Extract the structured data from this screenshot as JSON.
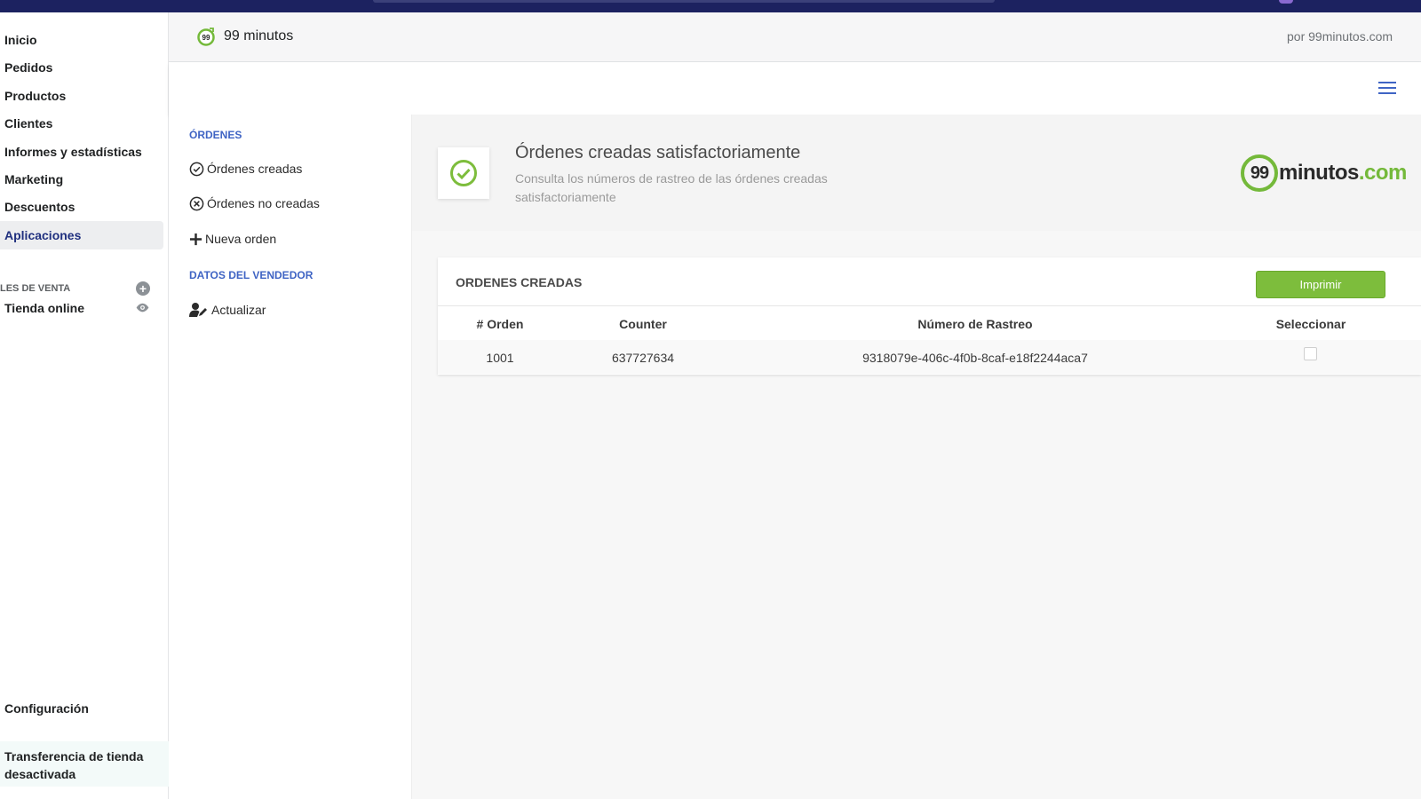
{
  "admin_nav": {
    "items": [
      {
        "label": "Inicio"
      },
      {
        "label": "Pedidos"
      },
      {
        "label": "Productos"
      },
      {
        "label": "Clientes"
      },
      {
        "label": "Informes y estadísticas"
      },
      {
        "label": "Marketing"
      },
      {
        "label": "Descuentos"
      },
      {
        "label": "Aplicaciones",
        "active": true
      }
    ],
    "channels_label": "LES DE VENTA",
    "channel_item": "Tienda online",
    "settings": "Configuración",
    "transfer": "Transferencia de tienda desactivada"
  },
  "app_header": {
    "title": "99 minutos",
    "by": "por 99minutos.com",
    "logo_badge": "99"
  },
  "side_nav": {
    "orders_heading": "ÓRDENES",
    "created": "Órdenes creadas",
    "not_created": "Órdenes no creadas",
    "new_order": "Nueva orden",
    "vendor_heading": "DATOS DEL VENDEDOR",
    "update": "Actualizar"
  },
  "banner": {
    "title": "Órdenes creadas satisfactoriamente",
    "description": "Consulta los números de rastreo de las órdenes creadas satisfactoriamente",
    "brand_number": "99",
    "brand_name": "minutos",
    "brand_tld": ".com"
  },
  "orders": {
    "title": "ORDENES CREADAS",
    "print_label": "Imprimir",
    "columns": [
      "# Orden",
      "Counter",
      "Número de Rastreo",
      "Seleccionar"
    ],
    "rows": [
      {
        "order": "1001",
        "counter": "637727634",
        "tracking": "9318079e-406c-4f0b-8caf-e18f2244aca7",
        "selected": false
      }
    ]
  },
  "colors": {
    "accent_green": "#7dbd3c",
    "brand_navy": "#1c2260",
    "link_blue": "#3f64c4"
  }
}
